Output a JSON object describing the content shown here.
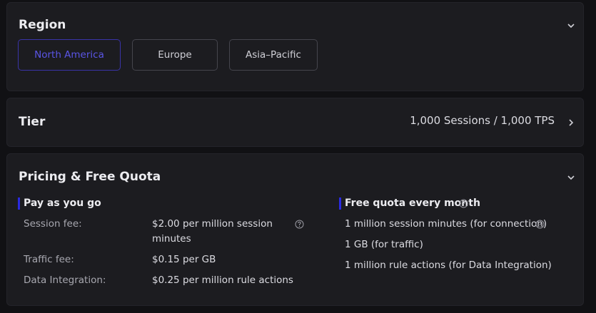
{
  "region": {
    "title": "Region",
    "options": [
      "North America",
      "Europe",
      "Asia–Pacific"
    ],
    "selected": "North America"
  },
  "tier": {
    "title": "Tier",
    "value": "1,000 Sessions / 1,000 TPS"
  },
  "pricing": {
    "title": "Pricing & Free Quota",
    "payg": {
      "heading": "Pay as you go",
      "rows": [
        {
          "label": "Session fee:",
          "value_line1": "$2.00 per million session",
          "value_line2": "minutes"
        },
        {
          "label": "Traffic fee:",
          "value": "$0.15 per GB"
        },
        {
          "label": "Data Integration:",
          "value": "$0.25 per million rule actions"
        }
      ]
    },
    "free": {
      "heading": "Free quota every month",
      "items": [
        "1 million session minutes (for connection)",
        "1 GB (for traffic)",
        "1 million rule actions (for Data Integration)"
      ]
    }
  },
  "colors": {
    "accent": "#5a55e6",
    "marker": "#2a2ae0",
    "card_bg": "#1c1c20",
    "page_bg": "#111114"
  },
  "icons": [
    "chevron-down-icon",
    "chevron-right-icon",
    "help-icon"
  ]
}
